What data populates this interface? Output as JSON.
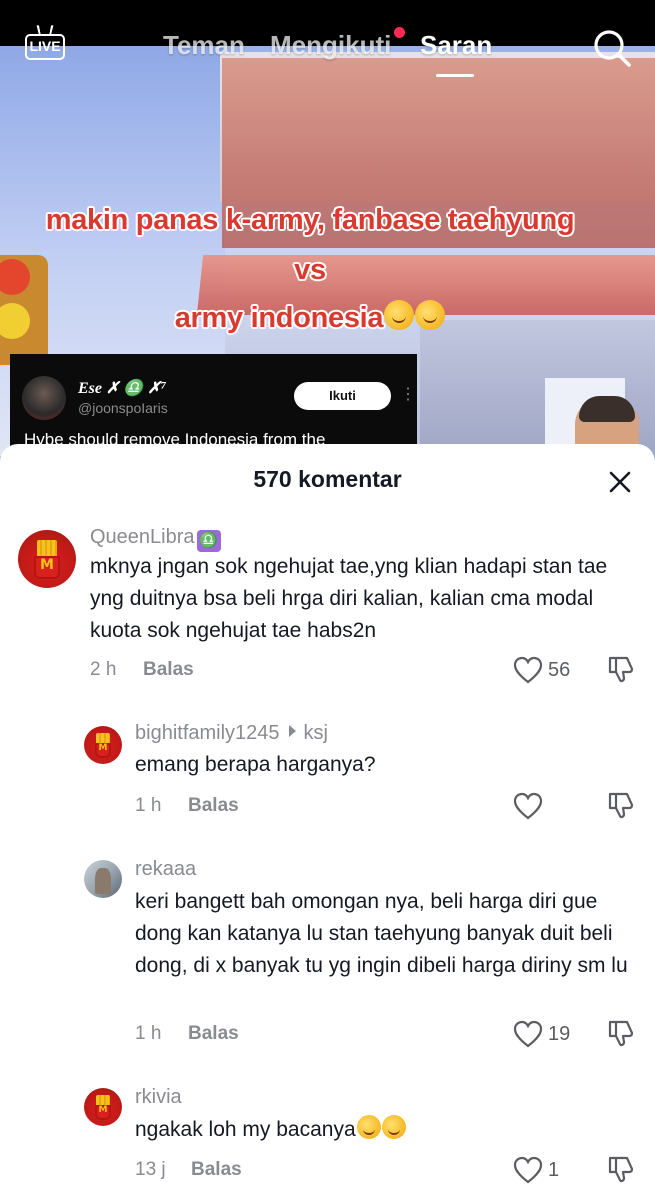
{
  "nav": {
    "live_label": "LIVE",
    "tabs": [
      {
        "label": "Teman"
      },
      {
        "label": "Mengikuti"
      },
      {
        "label": "Saran"
      }
    ]
  },
  "video": {
    "overlay_lines": [
      "makin panas  k-army, fanbase taehyung",
      "vs",
      "army indonesia"
    ],
    "tweet": {
      "name": "Ese ✗ ♎ ✗⁷",
      "handle": "@joonspoIaris",
      "follow_label": "Ikuti",
      "text": "Hybe should remove Indonesia from the"
    }
  },
  "comments_panel": {
    "title": "570 komentar",
    "comments": [
      {
        "username": "QueenLibra",
        "badge": "♎",
        "text": "mknya jngan sok ngehujat tae,yng klian hadapi stan tae yng duitnya bsa beli hrga diri kalian, kalian cma modal kuota sok ngehujat tae habs2n",
        "time": "2 h",
        "reply_label": "Balas",
        "likes": "56"
      },
      {
        "username": "bighitfamily1245",
        "reply_to": "ksj",
        "text": "emang berapa harganya?",
        "time": "1 h",
        "reply_label": "Balas",
        "likes": ""
      },
      {
        "username": "rekaaa",
        "text": "keri bangett bah omongan nya, beli harga diri gue dong kan katanya lu stan taehyung banyak duit beli dong, di x banyak tu yg ingin dibeli harga diriny sm lu",
        "time": "1 h",
        "reply_label": "Balas",
        "likes": "19"
      },
      {
        "username": "rkivia",
        "text": "ngakak loh my bacanya",
        "time": "13 j",
        "reply_label": "Balas",
        "likes": "1"
      }
    ]
  },
  "colors": {
    "accent_red": "#fe2c55",
    "overlay_text": "#d93a2f",
    "muted": "#8a8b91"
  },
  "icons": [
    "live-icon",
    "search-icon",
    "close-icon",
    "heart-icon",
    "dislike-icon",
    "libra-icon",
    "rofl-emoji"
  ]
}
